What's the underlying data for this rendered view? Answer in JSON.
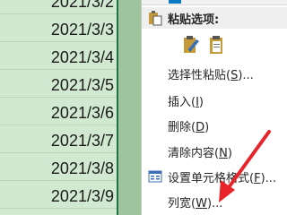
{
  "sheet": {
    "dates": [
      "2021/3/2",
      "2021/3/3",
      "2021/3/4",
      "2021/3/5",
      "2021/3/6",
      "2021/3/7",
      "2021/3/8",
      "2021/3/9"
    ]
  },
  "menu": {
    "paste_options": {
      "label": "粘贴选项:"
    },
    "paste_special": {
      "label": "选择性粘贴(",
      "key": "S",
      "suffix": ")..."
    },
    "insert": {
      "label": "插入(",
      "key": "I",
      "suffix": ")"
    },
    "delete": {
      "label": "删除(",
      "key": "D",
      "suffix": ")"
    },
    "clear": {
      "label": "清除内容(",
      "key": "N",
      "suffix": ")"
    },
    "format_cells": {
      "label": "设置单元格格式(",
      "key": "F",
      "suffix": ")..."
    },
    "column_width": {
      "label": "列宽(",
      "key": "W",
      "suffix": ")..."
    }
  },
  "colors": {
    "sheet_bg": "#d1e9d1",
    "accent_blue": "#0a7bc2",
    "arrow_red": "#e8242a",
    "excel_green": "#217346"
  },
  "icons": [
    "paste-icon",
    "paste-format-icon",
    "paste-values-icon",
    "format-cells-icon"
  ]
}
